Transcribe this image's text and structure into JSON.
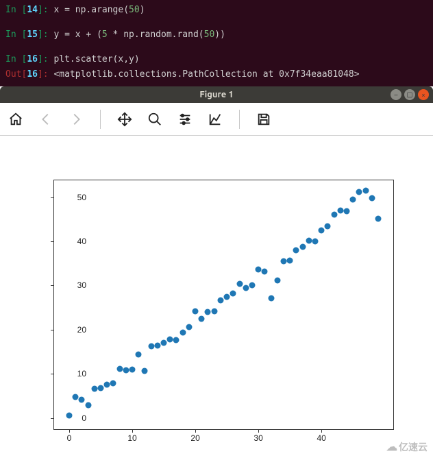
{
  "terminal": {
    "lines": [
      {
        "in": "14",
        "code_pre": "x ",
        "eq": "=",
        "mid": " np.arange(",
        "num": "50",
        "post": ")"
      },
      {
        "in": "15",
        "code_pre": "y ",
        "eq": "=",
        "mid": " x + (",
        "num": "5",
        "mid2": " * np.random.rand(",
        "num2": "50",
        "post": "))"
      },
      {
        "in": "16",
        "code_pre": "plt.scatter(x,y)"
      },
      {
        "out": "16",
        "text": "<matplotlib.collections.PathCollection at 0x7f34eaa81048>"
      }
    ]
  },
  "window": {
    "title": "Figure 1"
  },
  "toolbar": {
    "icons": [
      "home",
      "back",
      "forward",
      "move",
      "zoom",
      "config",
      "axes",
      "save"
    ]
  },
  "chart_data": {
    "type": "scatter",
    "xlabel": "",
    "ylabel": "",
    "xlim": [
      -2.5,
      51.5
    ],
    "ylim": [
      -2.7,
      54.0
    ],
    "xticks": [
      0,
      10,
      20,
      30,
      40
    ],
    "yticks": [
      0,
      10,
      20,
      30,
      40,
      50
    ],
    "x": [
      0,
      1,
      2,
      3,
      4,
      5,
      6,
      7,
      8,
      9,
      10,
      11,
      12,
      13,
      14,
      15,
      16,
      17,
      18,
      19,
      20,
      21,
      22,
      23,
      24,
      25,
      26,
      27,
      28,
      29,
      30,
      31,
      32,
      33,
      34,
      35,
      36,
      37,
      38,
      39,
      40,
      41,
      42,
      43,
      44,
      45,
      46,
      47,
      48,
      49
    ],
    "y": [
      0.5,
      4.8,
      4.2,
      2.9,
      6.6,
      6.8,
      7.5,
      7.8,
      11.2,
      10.8,
      11.0,
      14.4,
      10.6,
      16.2,
      16.4,
      17.0,
      17.8,
      17.7,
      19.4,
      20.6,
      24.2,
      22.4,
      24.0,
      24.2,
      26.6,
      27.5,
      28.2,
      30.4,
      29.5,
      30.0,
      33.7,
      33.2,
      27.2,
      31.1,
      35.5,
      35.6,
      38.0,
      38.8,
      40.2,
      40.0,
      42.5,
      43.4,
      46.0,
      47.0,
      46.8,
      49.5,
      51.2,
      51.5,
      49.8,
      45.2
    ]
  },
  "watermark": "亿速云"
}
